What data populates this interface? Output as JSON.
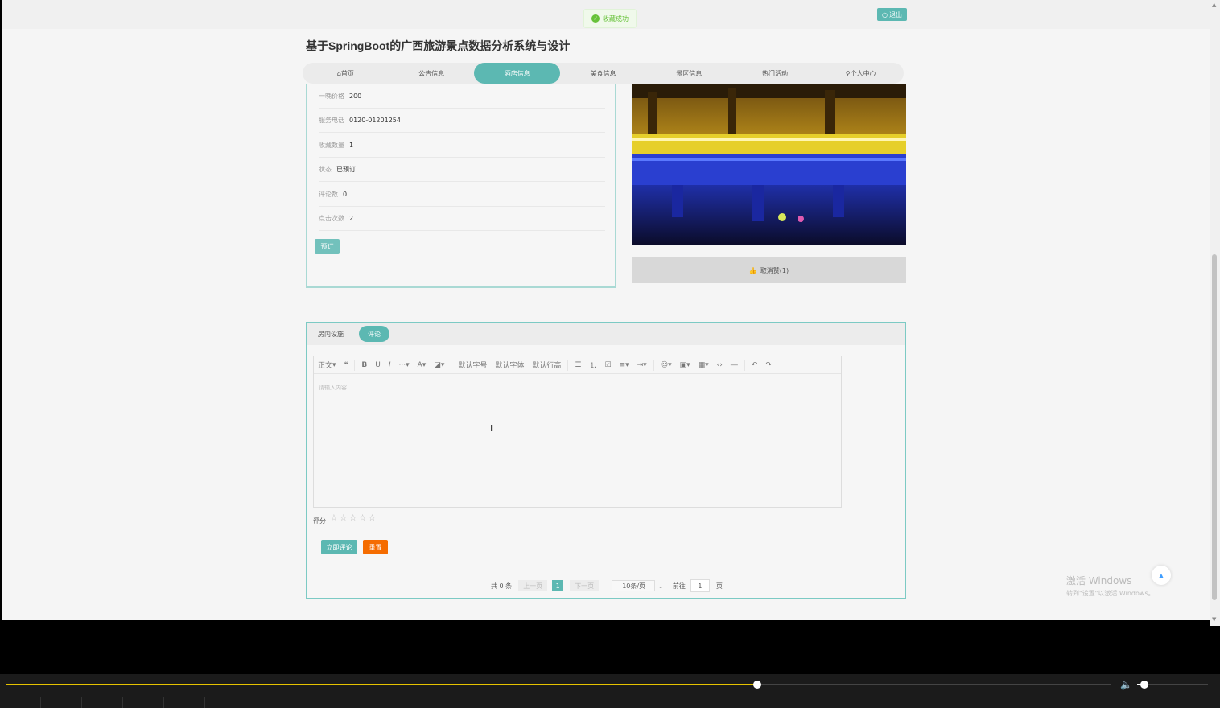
{
  "toast": {
    "text": "收藏成功",
    "icon": "check-circle-icon"
  },
  "header": {
    "logout_label": "退出",
    "title": "基于SpringBoot的广西旅游景点数据分析系统与设计"
  },
  "nav": {
    "items": [
      {
        "label": "⌂首页"
      },
      {
        "label": "公告信息"
      },
      {
        "label": "酒店信息"
      },
      {
        "label": "美食信息"
      },
      {
        "label": "景区信息"
      },
      {
        "label": "热门活动"
      },
      {
        "label": "⚲个人中心"
      }
    ],
    "active_index": 2
  },
  "hotel": {
    "fields": [
      {
        "label": "一晚价格",
        "value": "200"
      },
      {
        "label": "服务电话",
        "value": "0120-01201254"
      },
      {
        "label": "收藏数量",
        "value": "1"
      },
      {
        "label": "状态",
        "value": "已预订"
      },
      {
        "label": "评论数",
        "value": "0"
      },
      {
        "label": "点击次数",
        "value": "2"
      }
    ],
    "book_label": "预订",
    "unlike_label": "取消赞(1)"
  },
  "comments": {
    "tabs": [
      {
        "label": "房内设施"
      },
      {
        "label": "评论"
      }
    ],
    "active_tab": 1,
    "toolbar": {
      "paragraph": "正文",
      "font_size": "默认字号",
      "font_family": "默认字体",
      "line_height": "默认行高"
    },
    "placeholder": "请输入内容...",
    "rating_label": "评分",
    "stars": "☆☆☆☆☆",
    "submit_label": "立即评论",
    "reset_label": "重置"
  },
  "pager": {
    "total": "共 0 条",
    "prev": "上一页",
    "current": "1",
    "next": "下一页",
    "page_size": "10条/页",
    "goto_label": "前往",
    "goto_value": "1",
    "page_unit": "页"
  },
  "watermark": {
    "line1": "激活 Windows",
    "line2": "转到\"设置\"以激活 Windows。"
  },
  "player": {
    "progress": 0.68,
    "volume": 0.1
  },
  "colors": {
    "accent": "#5cb8b2",
    "reset": "#f56c00",
    "seek": "#e5c200"
  }
}
